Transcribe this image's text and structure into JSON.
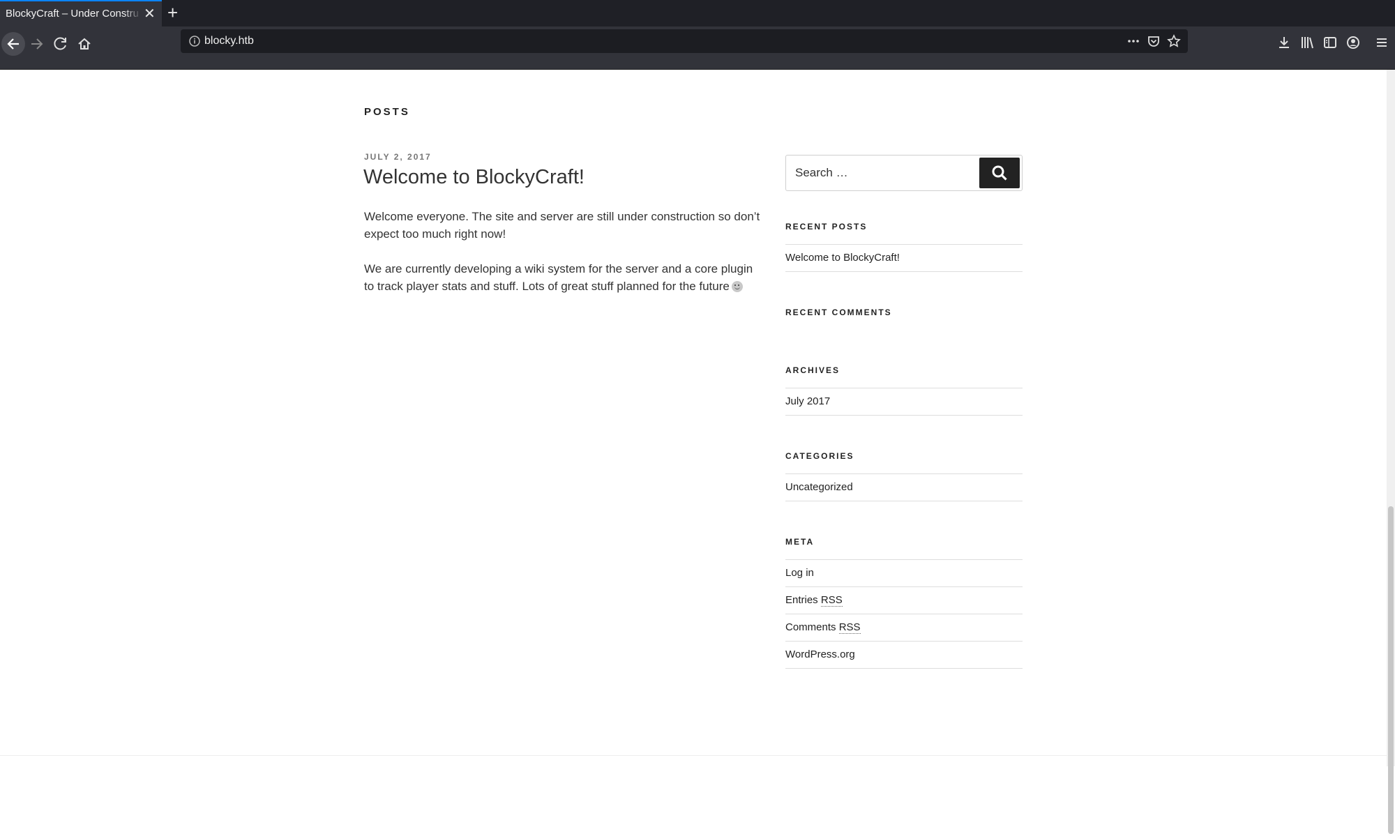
{
  "browser": {
    "tab_title": "BlockyCraft – Under Construction!",
    "tab_close": "✕",
    "new_tab": "+",
    "url": "blocky.htb"
  },
  "page": {
    "posts_heading": "POSTS",
    "post": {
      "date": "JULY 2, 2017",
      "title": "Welcome to BlockyCraft!",
      "paragraphs": [
        "Welcome everyone. The site and server are still under construction so don’t expect too much right now!",
        "We are currently developing a wiki system for the server and a core plugin to track player stats and stuff. Lots of great stuff planned for the future"
      ]
    },
    "sidebar": {
      "search_placeholder": "Search …",
      "recent_posts": {
        "title": "RECENT POSTS",
        "items": [
          "Welcome to BlockyCraft!"
        ]
      },
      "recent_comments": {
        "title": "RECENT COMMENTS"
      },
      "archives": {
        "title": "ARCHIVES",
        "items": [
          "July 2017"
        ]
      },
      "categories": {
        "title": "CATEGORIES",
        "items": [
          "Uncategorized"
        ]
      },
      "meta": {
        "title": "META",
        "items": [
          "Log in",
          "Entries",
          "RSS",
          "Comments",
          "RSS",
          "WordPress.org"
        ]
      }
    }
  }
}
